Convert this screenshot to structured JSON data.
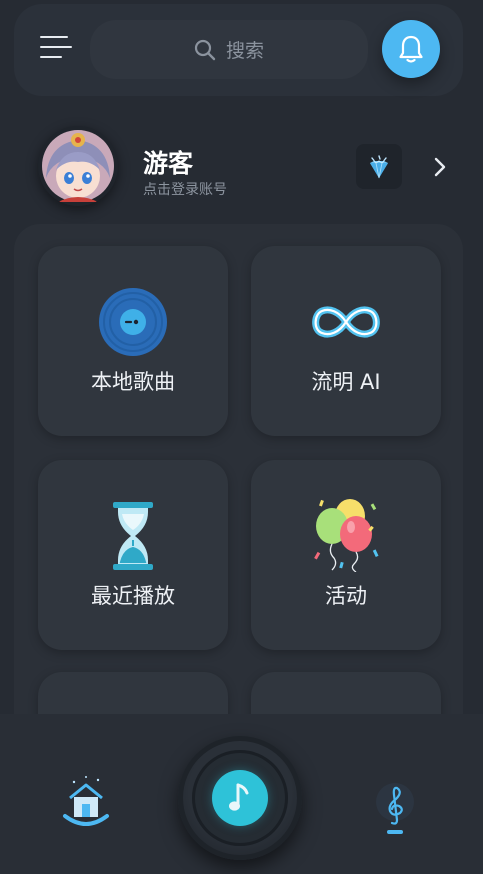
{
  "search": {
    "placeholder": "搜索",
    "icon": "search-icon"
  },
  "header": {
    "menu_icon": "menu-icon",
    "bell_icon": "bell-icon",
    "accent": "#4db8f2"
  },
  "profile": {
    "name": "游客",
    "hint": "点击登录账号",
    "vip_icon": "diamond-icon",
    "chevron_icon": "chevron-right-icon"
  },
  "grid": [
    {
      "label": "本地歌曲",
      "icon": "vinyl-record-icon"
    },
    {
      "label": "流明 AI",
      "icon": "infinity-icon"
    },
    {
      "label": "最近播放",
      "icon": "hourglass-icon"
    },
    {
      "label": "活动",
      "icon": "balloons-icon"
    }
  ],
  "bottom_nav": {
    "home_icon": "home-icon",
    "play_icon": "music-note-icon",
    "music_icon": "treble-clef-icon",
    "play_color": "#2ec2d8"
  }
}
